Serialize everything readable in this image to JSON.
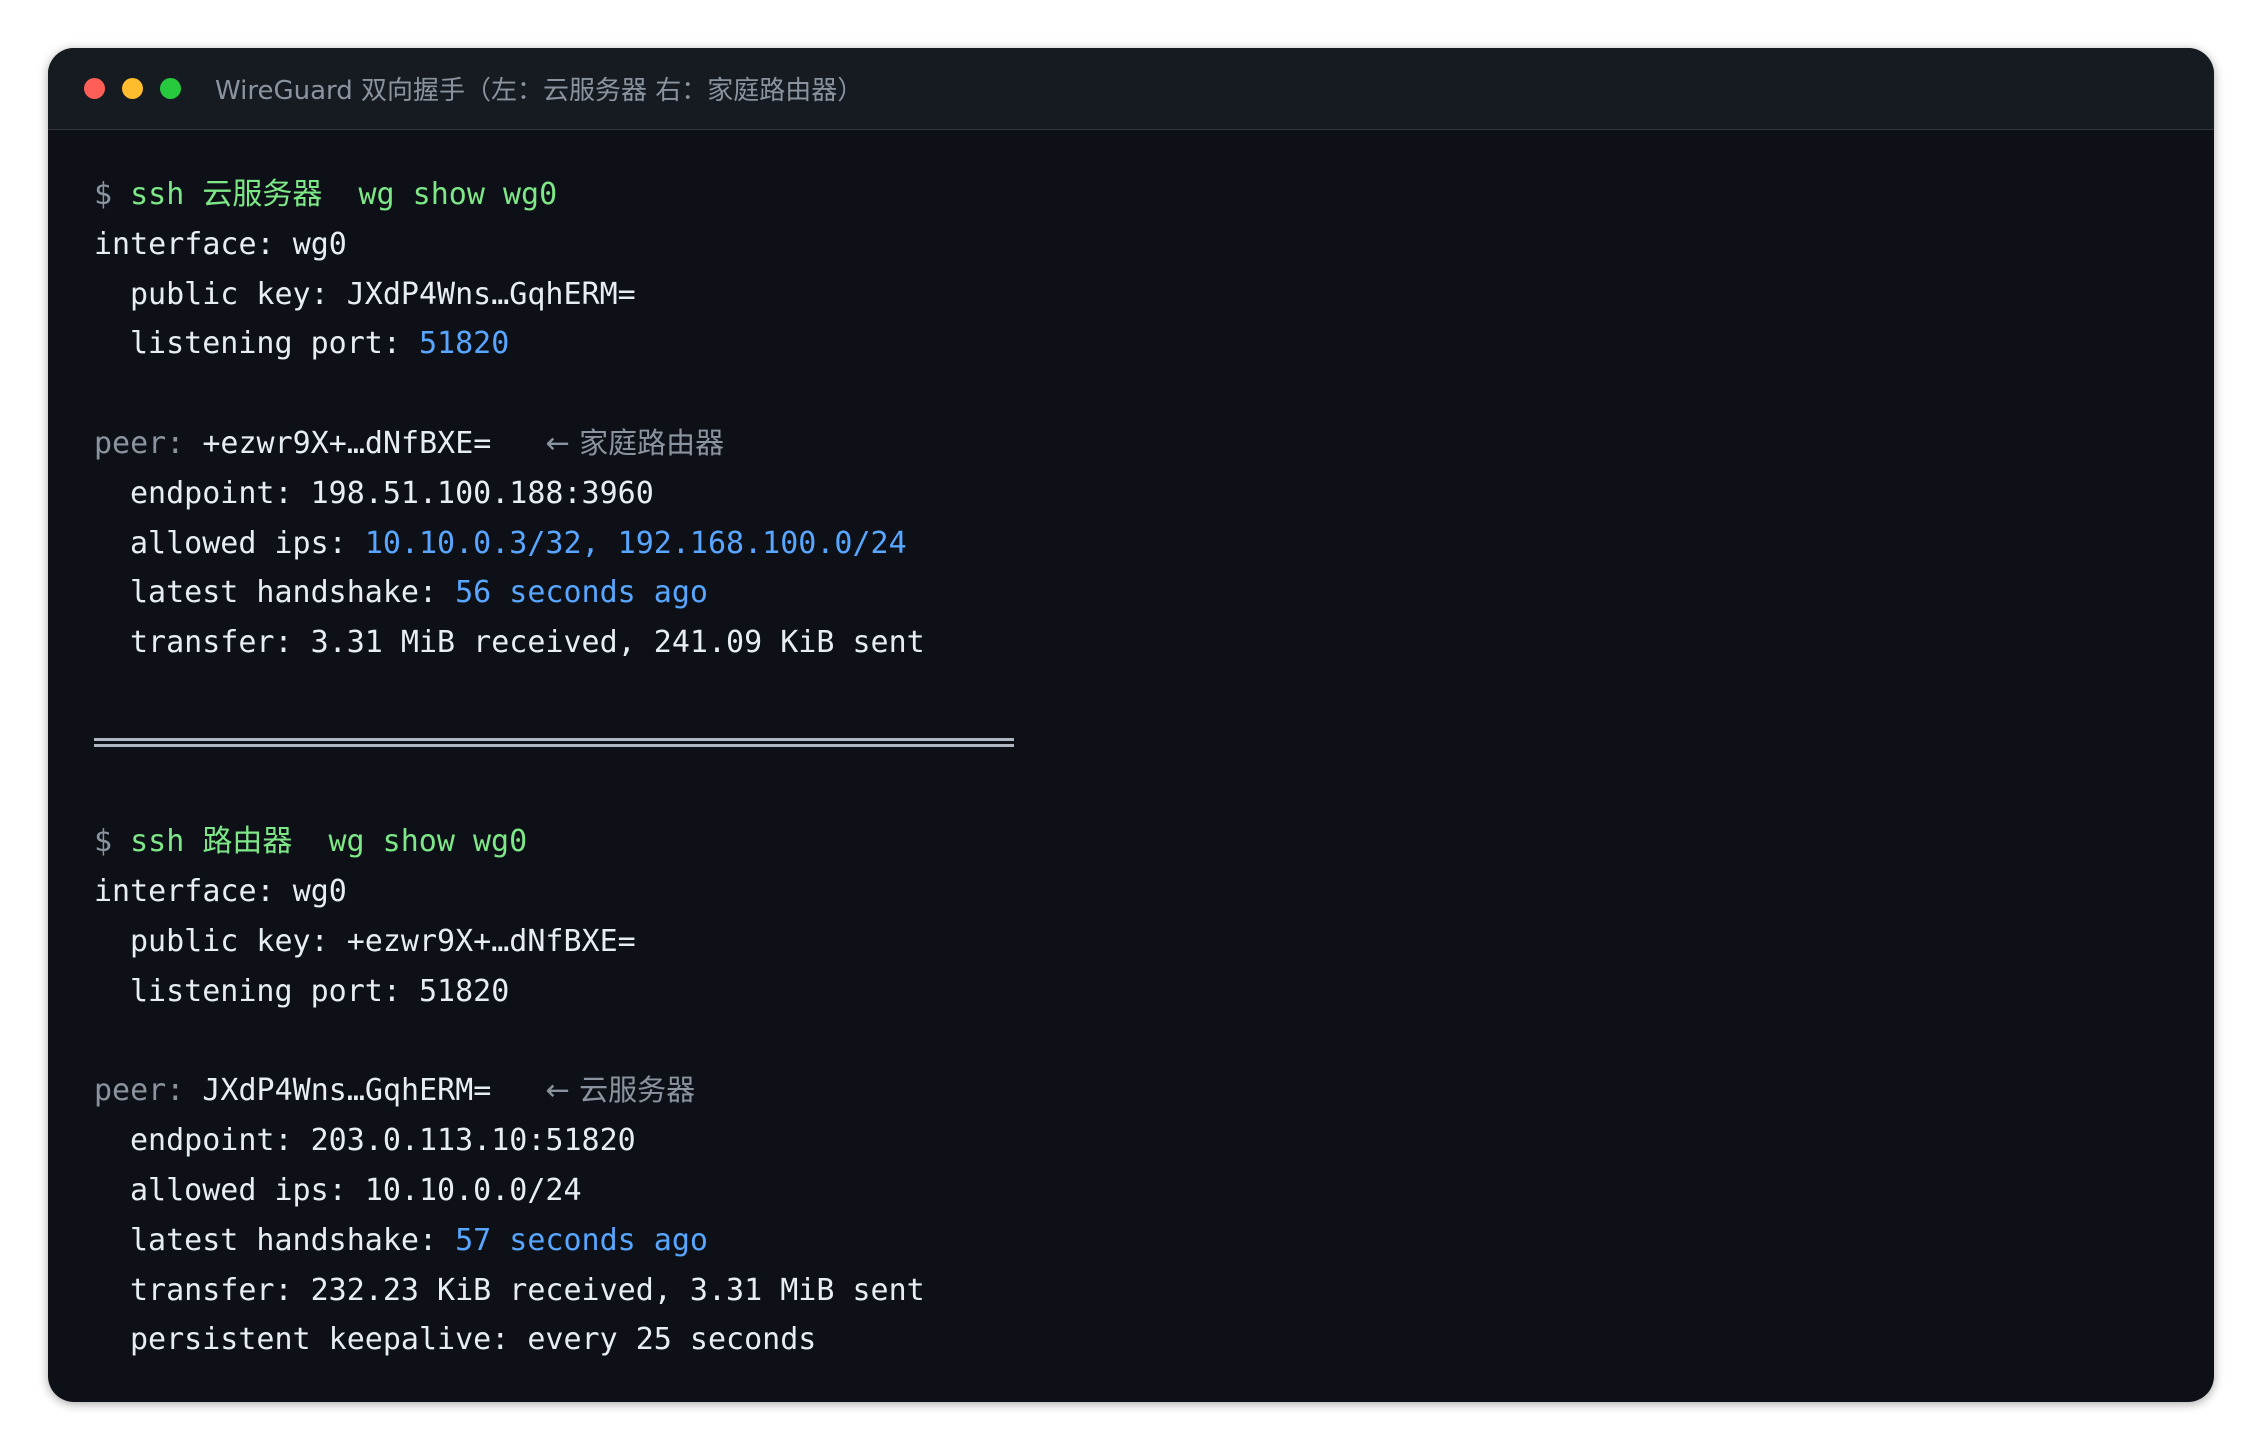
{
  "window": {
    "title": "WireGuard 双向握手（左：云服务器 右：家庭路由器）"
  },
  "colors": {
    "background": "#0d1117",
    "titlebar": "#161b22",
    "command": "#7ee787",
    "highlight": "#58a6ff",
    "muted": "#8b949e",
    "text": "#e6edf3"
  },
  "server": {
    "prompt": "$",
    "cmd_ssh": "ssh",
    "host": "云服务器",
    "cmd_rest": "wg show wg0",
    "interface_label": "interface:",
    "interface_value": "wg0",
    "public_key_label": "public key:",
    "public_key_value": "JXdP4Wns…GqhERM=",
    "listening_port_label": "listening port:",
    "listening_port_value": "51820",
    "peer_label": "peer:",
    "peer_value": "+ezwr9X+…dNfBXE=",
    "peer_note": "← 家庭路由器",
    "endpoint_label": "endpoint:",
    "endpoint_value": "198.51.100.188:3960",
    "allowed_ips_label": "allowed ips:",
    "allowed_ips_value": "10.10.0.3/32, 192.168.100.0/24",
    "handshake_label": "latest handshake:",
    "handshake_value": "56 seconds ago",
    "transfer_label": "transfer:",
    "transfer_value": "3.31 MiB received, 241.09 KiB sent"
  },
  "router": {
    "prompt": "$",
    "cmd_ssh": "ssh",
    "host": "路由器",
    "cmd_rest": "wg show wg0",
    "interface_label": "interface:",
    "interface_value": "wg0",
    "public_key_label": "public key:",
    "public_key_value": "+ezwr9X+…dNfBXE=",
    "listening_port_label": "listening port:",
    "listening_port_value": "51820",
    "peer_label": "peer:",
    "peer_value": "JXdP4Wns…GqhERM=",
    "peer_note": "← 云服务器",
    "endpoint_label": "endpoint:",
    "endpoint_value": "203.0.113.10:51820",
    "allowed_ips_label": "allowed ips:",
    "allowed_ips_value": "10.10.0.0/24",
    "handshake_label": "latest handshake:",
    "handshake_value": "57 seconds ago",
    "transfer_label": "transfer:",
    "transfer_value": "232.23 KiB received, 3.31 MiB sent",
    "keepalive_label": "persistent keepalive:",
    "keepalive_value": "every 25 seconds"
  }
}
